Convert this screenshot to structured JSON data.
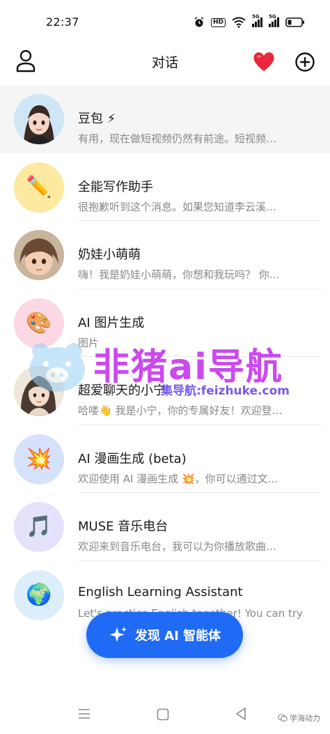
{
  "status_bar": {
    "time": "22:37",
    "hd_label": "HD",
    "signal_label_1": "5G",
    "signal_label_2": "5G"
  },
  "header": {
    "title": "对话"
  },
  "chats": [
    {
      "name": "豆包 ⚡",
      "preview": "有用，现在做短视频仍然有前途。短视频…",
      "avatar": "cartoon-girl-avatar"
    },
    {
      "name": "全能写作助手",
      "preview": "很抱歉听到这个消息。如果您知道李云溪…",
      "avatar": "✏️"
    },
    {
      "name": "奶娃小萌萌",
      "preview": "嗨！我是奶娃小萌萌，你想和我玩吗？ 你…",
      "avatar": "toddler-photo-avatar"
    },
    {
      "name": "AI 图片生成",
      "preview": "图片",
      "avatar": "🎨"
    },
    {
      "name": "超爱聊天的小宁",
      "preview": "哈喽👋 我是小宁，你的专属好友！欢迎登…",
      "avatar": "girl-illustration-avatar"
    },
    {
      "name": "AI 漫画生成 (beta)",
      "preview": "欢迎使用 AI 漫画生成 💥，你可以通过文…",
      "avatar": "💥"
    },
    {
      "name": "MUSE 音乐电台",
      "preview": "欢迎来到音乐电台，我可以为你播放歌曲…",
      "avatar": "🎵"
    },
    {
      "name": "English Learning Assistant",
      "preview": "Let's practice English together! You can try…",
      "avatar": "🌍"
    }
  ],
  "discover_button": {
    "label": "发现 AI 智能体"
  },
  "watermark": {
    "title": "非猪ai导航",
    "subtitle": "集导航:feizhuke.com"
  },
  "credit": {
    "text": "学海动力"
  },
  "colors": {
    "accent": "#1f6bf6",
    "heart": "#e8283a",
    "watermark": "#c73aee"
  }
}
